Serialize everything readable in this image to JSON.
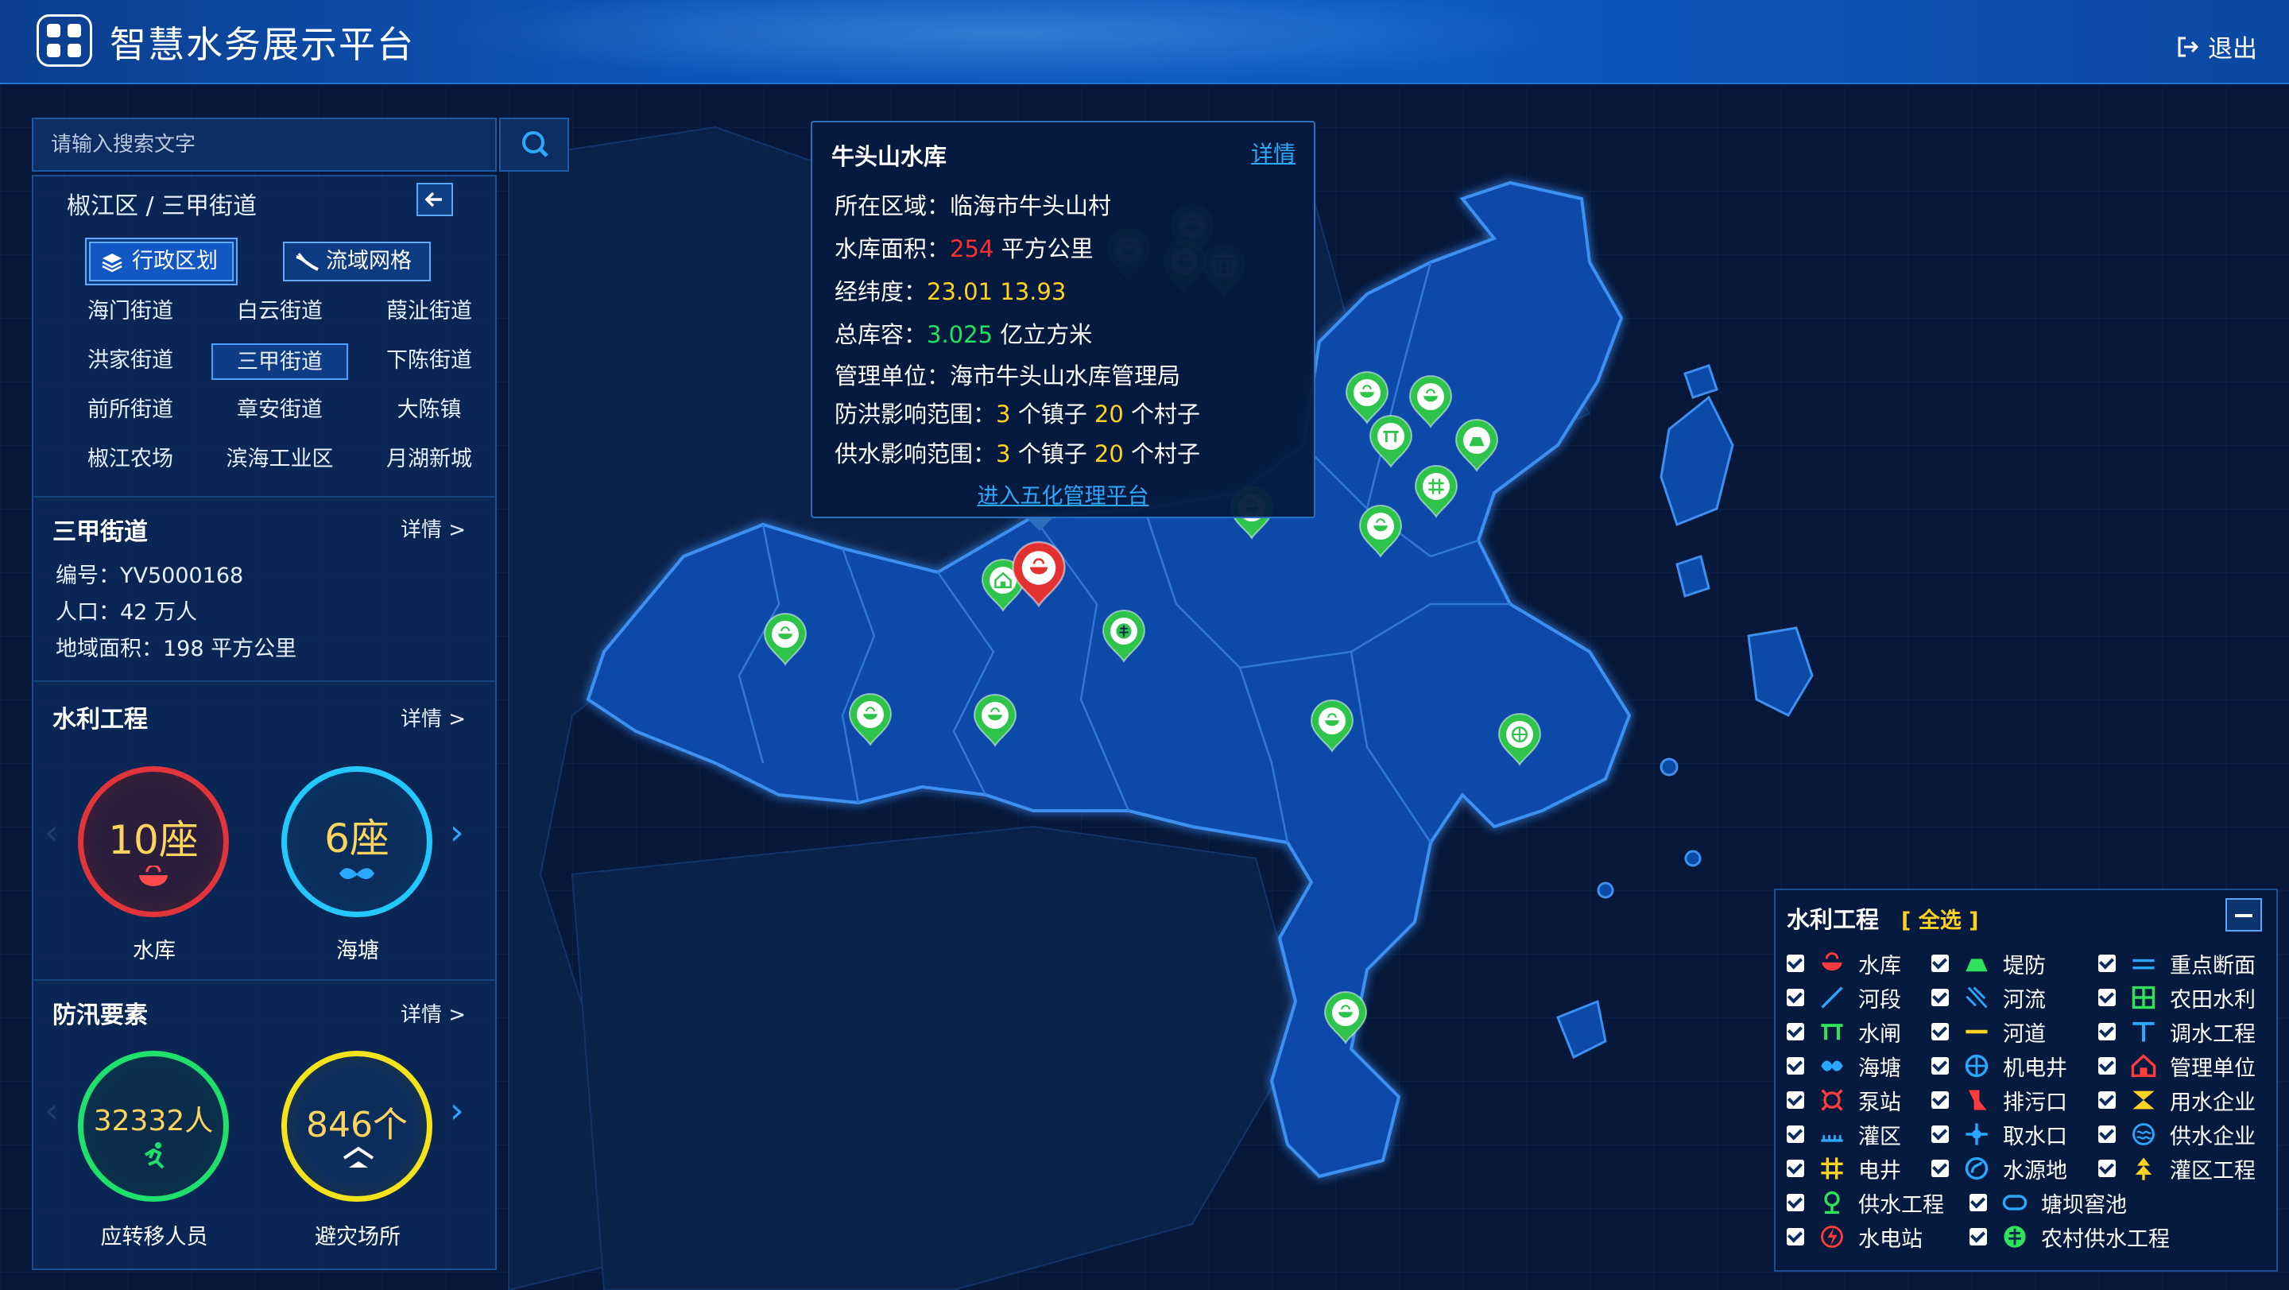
{
  "header": {
    "title": "智慧水务展示平台",
    "logout": "退出"
  },
  "search": {
    "placeholder": "请输入搜索文字"
  },
  "region": {
    "breadcrumb": "椒江区 / 三甲街道",
    "mode_buttons": [
      "行政区划",
      "流域网格"
    ],
    "streets": [
      "海门街道",
      "白云街道",
      "葭沚街道",
      "洪家街道",
      "三甲街道",
      "下陈街道",
      "前所街道",
      "章安街道",
      "大陈镇",
      "椒江农场",
      "滨海工业区",
      "月湖新城"
    ],
    "selected_street": "三甲街道"
  },
  "district_info": {
    "title": "三甲街道",
    "more": "详情 >",
    "code": "编号：YV5000168",
    "population": "人口：42 万人",
    "area": "地域面积：198 平方公里"
  },
  "water_projects": {
    "title": "水利工程",
    "more": "详情 >",
    "items": [
      {
        "value": "10座",
        "label": "水库",
        "color": "#e2343b"
      },
      {
        "value": "6座",
        "label": "海塘",
        "color": "#22c8ff"
      }
    ]
  },
  "flood_elements": {
    "title": "防汛要素",
    "more": "详情 >",
    "items": [
      {
        "value": "32332人",
        "label": "应转移人员",
        "color": "#1fe06a"
      },
      {
        "value": "846个",
        "label": "避灾场所",
        "color": "#f4e21b"
      }
    ]
  },
  "popup": {
    "title": "牛头山水库",
    "detail": "详情",
    "region_label": "所在区域：",
    "region_value": "临海市牛头山村",
    "area_label": "水库面积：",
    "area_value": "254",
    "area_unit": "平方公里",
    "coord_label": "经纬度：",
    "coord_value": "23.01 13.93",
    "capacity_label": "总库容：",
    "capacity_value": "3.025",
    "capacity_unit": "亿立方米",
    "unit_label": "管理单位：",
    "unit_value": "海市牛头山水库管理局",
    "flood_label": "防洪影响范围：",
    "flood_towns": "3",
    "flood_villages": "20",
    "supply_label": "供水影响范围：",
    "supply_towns": "3",
    "supply_villages": "20",
    "town_word": "个镇子",
    "village_word": "个村子",
    "link": "进入五化管理平台"
  },
  "legend": {
    "title": "水利工程",
    "select_all": "[ 全选 ]",
    "items": [
      {
        "label": "水库",
        "icon": "reservoir-icon",
        "color": "#ff3b3b"
      },
      {
        "label": "堤防",
        "icon": "dike-icon",
        "color": "#2ee35b"
      },
      {
        "label": "重点断面",
        "icon": "key-section-icon",
        "color": "#2aa8ff"
      },
      {
        "label": "河段",
        "icon": "river-section-icon",
        "color": "#2aa8ff"
      },
      {
        "label": "河流",
        "icon": "river-icon",
        "color": "#2aa8ff"
      },
      {
        "label": "农田水利",
        "icon": "farmland-icon",
        "color": "#2ee35b"
      },
      {
        "label": "水闸",
        "icon": "sluice-icon",
        "color": "#2ee35b"
      },
      {
        "label": "河道",
        "icon": "channel-icon",
        "color": "#ffd21f"
      },
      {
        "label": "调水工程",
        "icon": "water-transfer-icon",
        "color": "#2aa8ff"
      },
      {
        "label": "海塘",
        "icon": "seawall-icon",
        "color": "#2aa8ff"
      },
      {
        "label": "机电井",
        "icon": "pump-well-icon",
        "color": "#2aa8ff"
      },
      {
        "label": "管理单位",
        "icon": "management-unit-icon",
        "color": "#ff3b3b"
      },
      {
        "label": "泵站",
        "icon": "pump-station-icon",
        "color": "#ff3b3b"
      },
      {
        "label": "排污口",
        "icon": "sewage-outlet-icon",
        "color": "#ff3b3b"
      },
      {
        "label": "用水企业",
        "icon": "water-user-icon",
        "color": "#ffd21f"
      },
      {
        "label": "灌区",
        "icon": "irrigation-area-icon",
        "color": "#2aa8ff"
      },
      {
        "label": "取水口",
        "icon": "intake-icon",
        "color": "#2aa8ff"
      },
      {
        "label": "供水企业",
        "icon": "water-supplier-icon",
        "color": "#2aa8ff"
      },
      {
        "label": "电井",
        "icon": "electric-well-icon",
        "color": "#ffd21f"
      },
      {
        "label": "水源地",
        "icon": "water-source-icon",
        "color": "#2aa8ff"
      },
      {
        "label": "灌区工程",
        "icon": "irrigation-project-icon",
        "color": "#ffd21f"
      },
      {
        "label": "供水工程",
        "icon": "water-supply-icon",
        "color": "#2ee35b"
      },
      {
        "label": "塘坝窖池",
        "icon": "pond-icon",
        "color": "#2aa8ff"
      },
      {
        "label": "水电站",
        "icon": "hydropower-icon",
        "color": "#ff3b3b"
      },
      {
        "label": "农村供水工程",
        "icon": "rural-water-icon",
        "color": "#2ee35b"
      }
    ]
  },
  "map": {
    "markers": [
      {
        "icon": "reservoir-icon",
        "color": "#2ec34b"
      },
      {
        "icon": "reservoir-icon",
        "color": "#2ec34b"
      },
      {
        "icon": "reservoir-icon",
        "color": "#2ec34b"
      },
      {
        "icon": "farmland-icon",
        "color": "#2ec34b"
      },
      {
        "icon": "reservoir-icon",
        "color": "#2ec34b"
      },
      {
        "icon": "sluice-icon",
        "color": "#2ec34b"
      },
      {
        "icon": "reservoir-icon",
        "color": "#2ec34b"
      },
      {
        "icon": "management-unit-icon",
        "color": "#2ec34b"
      },
      {
        "icon": "reservoir-icon",
        "color": "#2ec34b"
      },
      {
        "icon": "rural-water-icon",
        "color": "#2ec34b"
      },
      {
        "icon": "dike-icon",
        "color": "#2ec34b"
      },
      {
        "icon": "reservoir-icon",
        "color": "#2ec34b"
      },
      {
        "icon": "electric-well-icon",
        "color": "#2ec34b"
      },
      {
        "icon": "reservoir-icon",
        "color": "#2ec34b"
      },
      {
        "icon": "reservoir-icon",
        "color": "#2ec34b"
      },
      {
        "icon": "pump-well-icon",
        "color": "#2ec34b"
      },
      {
        "icon": "reservoir-icon",
        "color": "#2ec34b"
      },
      {
        "icon": "reservoir-icon",
        "color": "#2ec34b"
      },
      {
        "icon": "reservoir-icon",
        "color": "#2ec34b"
      },
      {
        "icon": "reservoir-icon",
        "color": "#e23131",
        "selected": true
      }
    ]
  }
}
